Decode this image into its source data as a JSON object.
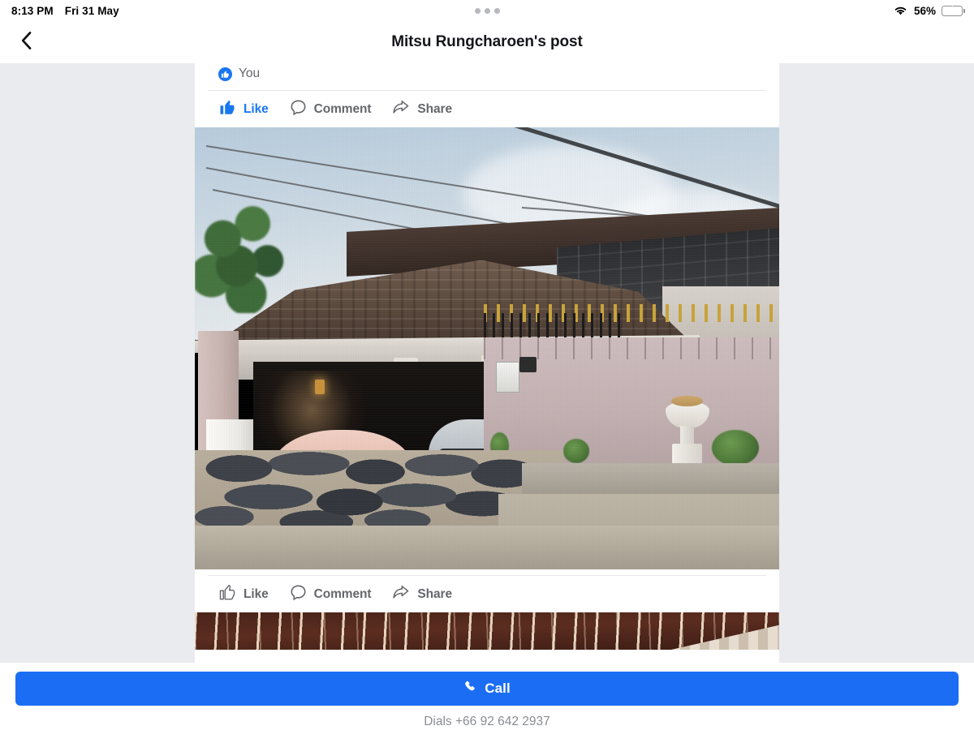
{
  "status_bar": {
    "time": "8:13 PM",
    "date": "Fri 31 May",
    "battery_percent": "56%",
    "wifi_icon": "wifi-icon",
    "battery_icon": "battery-charging-icon",
    "multitask_dots_icon": "more-dots-icon"
  },
  "nav": {
    "back_icon": "chevron-left-icon",
    "title": "Mitsu Rungcharoen's post"
  },
  "post": {
    "reaction": {
      "icon": "thumbs-up-circle-icon",
      "who": "You"
    },
    "actions_top": [
      {
        "label": "Like",
        "icon": "thumbs-up-filled-icon",
        "active": true
      },
      {
        "label": "Comment",
        "icon": "comment-bubble-icon",
        "active": false
      },
      {
        "label": "Share",
        "icon": "share-arrow-icon",
        "active": false
      }
    ],
    "actions_bottom": [
      {
        "label": "Like",
        "icon": "thumbs-up-outline-icon",
        "active": false
      },
      {
        "label": "Comment",
        "icon": "comment-bubble-icon",
        "active": false
      },
      {
        "label": "Share",
        "icon": "share-arrow-icon",
        "active": false
      }
    ],
    "photo_main_alt": "Two-storey house with tiled roof, open carport holding a pink compact car and a silver sedan, flagstone driveway, pink boundary wall with gold-tipped gate and white urn planter",
    "photo_second_alt": "Cropped top edge of a second photo showing a dark brown tiled roof"
  },
  "call_bar": {
    "button_label": "Call",
    "phone_icon": "phone-handset-icon",
    "dials_text": "Dials +66 92 642 2937"
  },
  "colors": {
    "facebook_blue": "#1877f2",
    "call_button_blue": "#1b6ef3",
    "page_background": "#e9ebee",
    "card_background": "#ffffff",
    "secondary_text": "#65676b",
    "battery_green": "#32cd58"
  }
}
